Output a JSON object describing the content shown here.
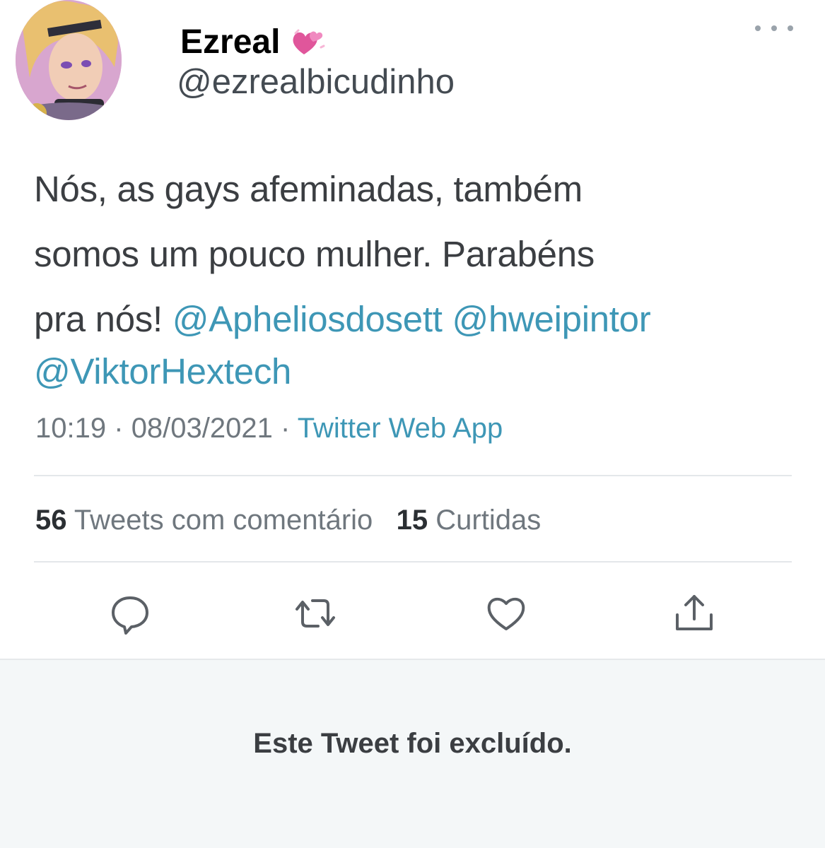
{
  "author": {
    "display_name": "Ezreal",
    "username": "@ezrealbicudinho"
  },
  "tweet": {
    "text_parts": [
      "Nós, as gays afeminadas, também",
      "somos um pouco mulher. Parabéns",
      "pra nós!"
    ],
    "mentions": [
      "@Apheliosdosett",
      "@hweipintor",
      "@ViktorHextech"
    ],
    "time": "10:19",
    "date": "08/03/2021",
    "separator": "·",
    "source": "Twitter Web App"
  },
  "stats": {
    "quote_count": "56",
    "quote_label": "Tweets com comentário",
    "like_count": "15",
    "like_label": "Curtidas"
  },
  "actions": {
    "icons": [
      "reply-icon",
      "retweet-icon",
      "like-icon",
      "share-icon"
    ]
  },
  "deleted_notice": "Este Tweet foi excluído.",
  "colors": {
    "link": "#3e97b6",
    "text": "#3b3e42",
    "muted": "#6f777e",
    "heart": "#e0569b"
  }
}
